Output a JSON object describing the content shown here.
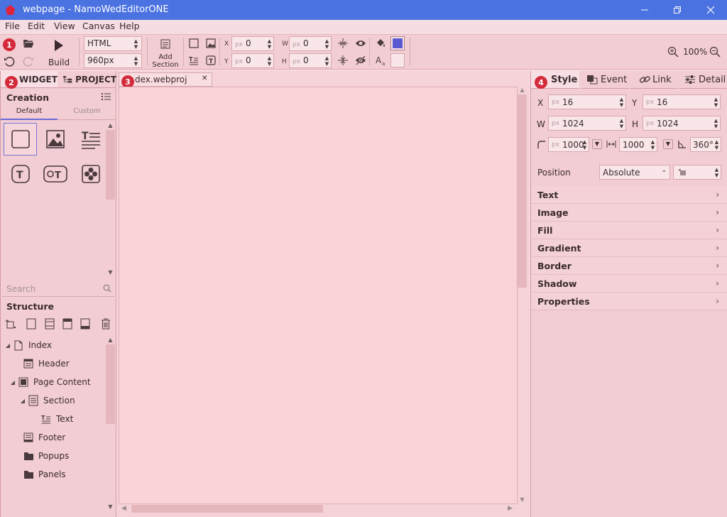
{
  "window": {
    "title": "webpage - NamoWedEditorONE",
    "controls": {
      "minimize": "—",
      "restore": "❐",
      "close": "✕"
    }
  },
  "menu": [
    "File",
    "Edit",
    "View",
    "Canvas",
    "Help"
  ],
  "toolbar": {
    "build_label": "Build",
    "doc_type": "HTML",
    "width_value": "960px",
    "add_section_line1": "Add",
    "add_section_line2": "Section",
    "x_label": "X",
    "y_label": "Y",
    "w_label": "W",
    "h_label": "H",
    "unit": "px",
    "x_value": "0",
    "y_value": "0",
    "w_value": "0",
    "h_value": "0",
    "fill_color": "#5a5ad0",
    "zoom": "100%"
  },
  "badges": [
    "1",
    "2",
    "3",
    "4"
  ],
  "left_panel": {
    "tabs": [
      "WIDGET",
      "PROJECT"
    ],
    "creation_title": "Creation",
    "subtabs": [
      "Default",
      "Custom"
    ],
    "search_placeholder": "Search",
    "structure_title": "Structure",
    "tree": [
      {
        "label": "Index"
      },
      {
        "label": "Header"
      },
      {
        "label": "Page Content"
      },
      {
        "label": "Section"
      },
      {
        "label": "Text"
      },
      {
        "label": "Footer"
      },
      {
        "label": "Popups"
      },
      {
        "label": "Panels"
      }
    ]
  },
  "document_tab": {
    "label": "dex.webproj",
    "close": "✕"
  },
  "right_panel": {
    "tabs": [
      "Style",
      "Event",
      "Link",
      "Detail"
    ],
    "x_label": "X",
    "y_label": "Y",
    "w_label": "W",
    "h_label": "H",
    "unit": "px",
    "x_value": "16",
    "y_value": "16",
    "w_value": "1024",
    "h_value": "1024",
    "radius_value": "1000",
    "spacing_value": "1000",
    "angle_value": "360°",
    "position_label": "Position",
    "position_value": "Absolute",
    "sections": [
      "Text",
      "Image",
      "Fill",
      "Gradient",
      "Border",
      "Shadow",
      "Properties"
    ]
  }
}
